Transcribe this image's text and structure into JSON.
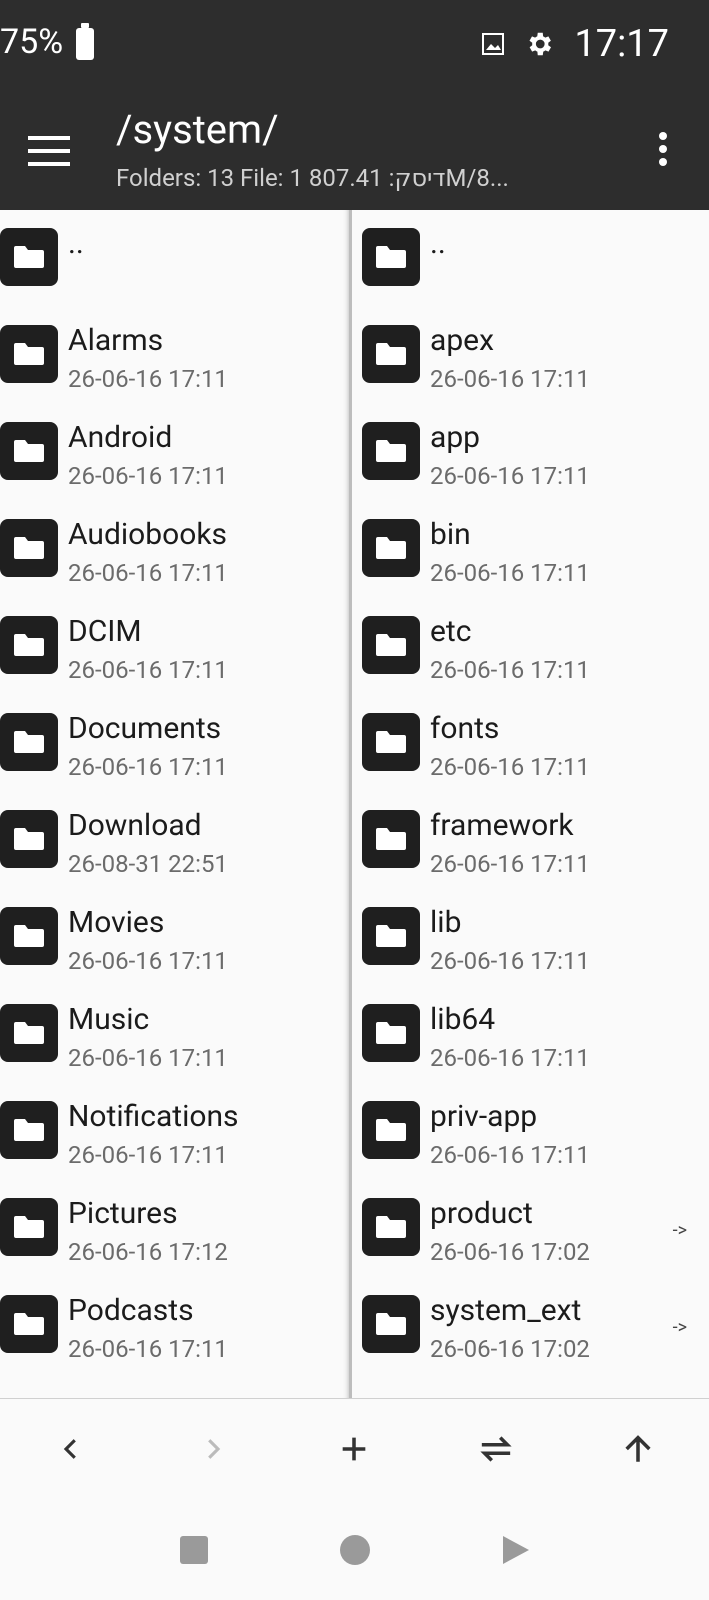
{
  "status_bar": {
    "battery": "75%",
    "time": "17:17"
  },
  "header": {
    "title": "/system/",
    "subtitle": "Folders: 13  File: 1  807.41 :דיסקM/8..."
  },
  "left_pane": [
    {
      "name": "..",
      "date": ""
    },
    {
      "name": "Alarms",
      "date": "26-06-16 17:11"
    },
    {
      "name": "Android",
      "date": "26-06-16 17:11"
    },
    {
      "name": "Audiobooks",
      "date": "26-06-16 17:11"
    },
    {
      "name": "DCIM",
      "date": "26-06-16 17:11"
    },
    {
      "name": "Documents",
      "date": "26-06-16 17:11"
    },
    {
      "name": "Download",
      "date": "26-08-31 22:51"
    },
    {
      "name": "Movies",
      "date": "26-06-16 17:11"
    },
    {
      "name": "Music",
      "date": "26-06-16 17:11"
    },
    {
      "name": "Notifications",
      "date": "26-06-16 17:11"
    },
    {
      "name": "Pictures",
      "date": "26-06-16 17:12"
    },
    {
      "name": "Podcasts",
      "date": "26-06-16 17:11"
    }
  ],
  "right_pane": [
    {
      "name": "..",
      "date": "",
      "link": ""
    },
    {
      "name": "apex",
      "date": "26-06-16 17:11",
      "link": ""
    },
    {
      "name": "app",
      "date": "26-06-16 17:11",
      "link": ""
    },
    {
      "name": "bin",
      "date": "26-06-16 17:11",
      "link": ""
    },
    {
      "name": "etc",
      "date": "26-06-16 17:11",
      "link": ""
    },
    {
      "name": "fonts",
      "date": "26-06-16 17:11",
      "link": ""
    },
    {
      "name": "framework",
      "date": "26-06-16 17:11",
      "link": ""
    },
    {
      "name": "lib",
      "date": "26-06-16 17:11",
      "link": ""
    },
    {
      "name": "lib64",
      "date": "26-06-16 17:11",
      "link": ""
    },
    {
      "name": "priv-app",
      "date": "26-06-16 17:11",
      "link": ""
    },
    {
      "name": "product",
      "date": "26-06-16 17:02",
      "link": "->"
    },
    {
      "name": "system_ext",
      "date": "26-06-16 17:02",
      "link": "->"
    }
  ]
}
